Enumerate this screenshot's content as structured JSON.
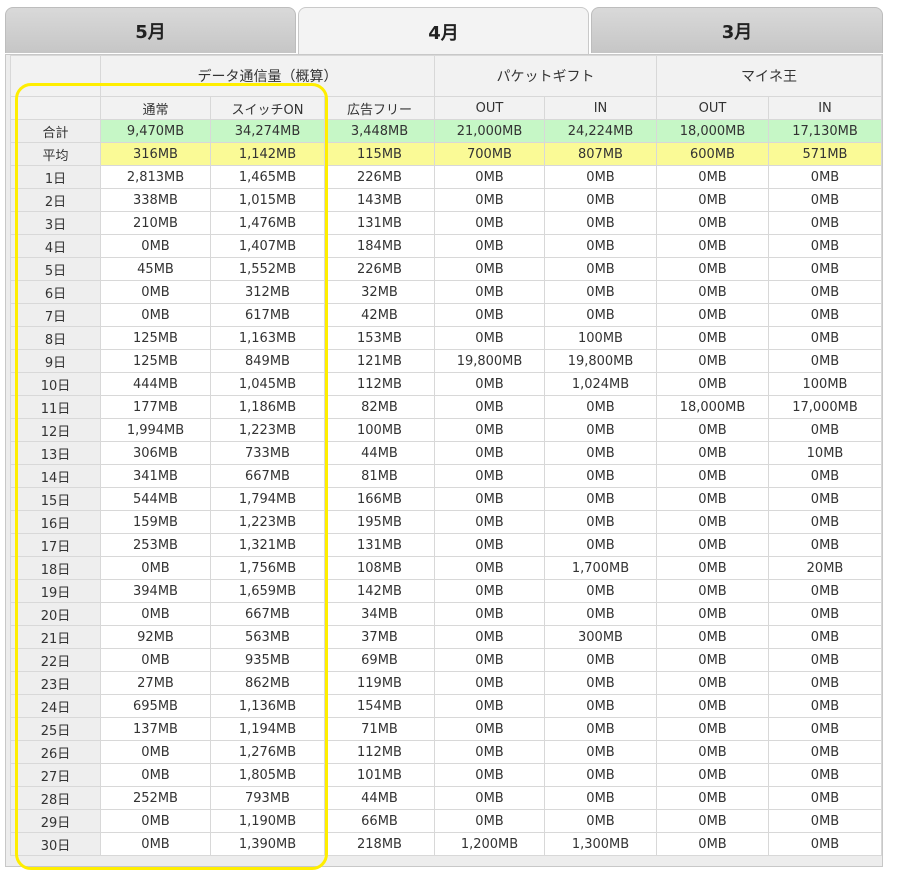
{
  "tabs": [
    {
      "label": "5月",
      "active": false
    },
    {
      "label": "4月",
      "active": true
    },
    {
      "label": "3月",
      "active": false
    }
  ],
  "header": {
    "group_data": "データ通信量（概算）",
    "group_packet": "パケットギフト",
    "group_maine": "マイネ王",
    "col_normal": "通常",
    "col_switch": "スイッチON",
    "col_adfree": "広告フリー",
    "col_out1": "OUT",
    "col_in1": "IN",
    "col_out2": "OUT",
    "col_in2": "IN"
  },
  "summary": {
    "total": {
      "label": "合計",
      "values": [
        "9,470MB",
        "34,274MB",
        "3,448MB",
        "21,000MB",
        "24,224MB",
        "18,000MB",
        "17,130MB"
      ]
    },
    "average": {
      "label": "平均",
      "values": [
        "316MB",
        "1,142MB",
        "115MB",
        "700MB",
        "807MB",
        "600MB",
        "571MB"
      ]
    }
  },
  "rows": [
    {
      "day": "1日",
      "v": [
        "2,813MB",
        "1,465MB",
        "226MB",
        "0MB",
        "0MB",
        "0MB",
        "0MB"
      ]
    },
    {
      "day": "2日",
      "v": [
        "338MB",
        "1,015MB",
        "143MB",
        "0MB",
        "0MB",
        "0MB",
        "0MB"
      ]
    },
    {
      "day": "3日",
      "v": [
        "210MB",
        "1,476MB",
        "131MB",
        "0MB",
        "0MB",
        "0MB",
        "0MB"
      ]
    },
    {
      "day": "4日",
      "v": [
        "0MB",
        "1,407MB",
        "184MB",
        "0MB",
        "0MB",
        "0MB",
        "0MB"
      ]
    },
    {
      "day": "5日",
      "v": [
        "45MB",
        "1,552MB",
        "226MB",
        "0MB",
        "0MB",
        "0MB",
        "0MB"
      ]
    },
    {
      "day": "6日",
      "v": [
        "0MB",
        "312MB",
        "32MB",
        "0MB",
        "0MB",
        "0MB",
        "0MB"
      ]
    },
    {
      "day": "7日",
      "v": [
        "0MB",
        "617MB",
        "42MB",
        "0MB",
        "0MB",
        "0MB",
        "0MB"
      ]
    },
    {
      "day": "8日",
      "v": [
        "125MB",
        "1,163MB",
        "153MB",
        "0MB",
        "100MB",
        "0MB",
        "0MB"
      ]
    },
    {
      "day": "9日",
      "v": [
        "125MB",
        "849MB",
        "121MB",
        "19,800MB",
        "19,800MB",
        "0MB",
        "0MB"
      ]
    },
    {
      "day": "10日",
      "v": [
        "444MB",
        "1,045MB",
        "112MB",
        "0MB",
        "1,024MB",
        "0MB",
        "100MB"
      ]
    },
    {
      "day": "11日",
      "v": [
        "177MB",
        "1,186MB",
        "82MB",
        "0MB",
        "0MB",
        "18,000MB",
        "17,000MB"
      ]
    },
    {
      "day": "12日",
      "v": [
        "1,994MB",
        "1,223MB",
        "100MB",
        "0MB",
        "0MB",
        "0MB",
        "0MB"
      ]
    },
    {
      "day": "13日",
      "v": [
        "306MB",
        "733MB",
        "44MB",
        "0MB",
        "0MB",
        "0MB",
        "10MB"
      ]
    },
    {
      "day": "14日",
      "v": [
        "341MB",
        "667MB",
        "81MB",
        "0MB",
        "0MB",
        "0MB",
        "0MB"
      ]
    },
    {
      "day": "15日",
      "v": [
        "544MB",
        "1,794MB",
        "166MB",
        "0MB",
        "0MB",
        "0MB",
        "0MB"
      ]
    },
    {
      "day": "16日",
      "v": [
        "159MB",
        "1,223MB",
        "195MB",
        "0MB",
        "0MB",
        "0MB",
        "0MB"
      ]
    },
    {
      "day": "17日",
      "v": [
        "253MB",
        "1,321MB",
        "131MB",
        "0MB",
        "0MB",
        "0MB",
        "0MB"
      ]
    },
    {
      "day": "18日",
      "v": [
        "0MB",
        "1,756MB",
        "108MB",
        "0MB",
        "1,700MB",
        "0MB",
        "20MB"
      ]
    },
    {
      "day": "19日",
      "v": [
        "394MB",
        "1,659MB",
        "142MB",
        "0MB",
        "0MB",
        "0MB",
        "0MB"
      ]
    },
    {
      "day": "20日",
      "v": [
        "0MB",
        "667MB",
        "34MB",
        "0MB",
        "0MB",
        "0MB",
        "0MB"
      ]
    },
    {
      "day": "21日",
      "v": [
        "92MB",
        "563MB",
        "37MB",
        "0MB",
        "300MB",
        "0MB",
        "0MB"
      ]
    },
    {
      "day": "22日",
      "v": [
        "0MB",
        "935MB",
        "69MB",
        "0MB",
        "0MB",
        "0MB",
        "0MB"
      ]
    },
    {
      "day": "23日",
      "v": [
        "27MB",
        "862MB",
        "119MB",
        "0MB",
        "0MB",
        "0MB",
        "0MB"
      ]
    },
    {
      "day": "24日",
      "v": [
        "695MB",
        "1,136MB",
        "154MB",
        "0MB",
        "0MB",
        "0MB",
        "0MB"
      ]
    },
    {
      "day": "25日",
      "v": [
        "137MB",
        "1,194MB",
        "71MB",
        "0MB",
        "0MB",
        "0MB",
        "0MB"
      ]
    },
    {
      "day": "26日",
      "v": [
        "0MB",
        "1,276MB",
        "112MB",
        "0MB",
        "0MB",
        "0MB",
        "0MB"
      ]
    },
    {
      "day": "27日",
      "v": [
        "0MB",
        "1,805MB",
        "101MB",
        "0MB",
        "0MB",
        "0MB",
        "0MB"
      ]
    },
    {
      "day": "28日",
      "v": [
        "252MB",
        "793MB",
        "44MB",
        "0MB",
        "0MB",
        "0MB",
        "0MB"
      ]
    },
    {
      "day": "29日",
      "v": [
        "0MB",
        "1,190MB",
        "66MB",
        "0MB",
        "0MB",
        "0MB",
        "0MB"
      ]
    },
    {
      "day": "30日",
      "v": [
        "0MB",
        "1,390MB",
        "218MB",
        "1,200MB",
        "1,300MB",
        "0MB",
        "0MB"
      ]
    }
  ],
  "colors": {
    "total_row": "#c6f7c6",
    "average_row": "#fafa96",
    "highlight_outline": "#ffee00"
  }
}
